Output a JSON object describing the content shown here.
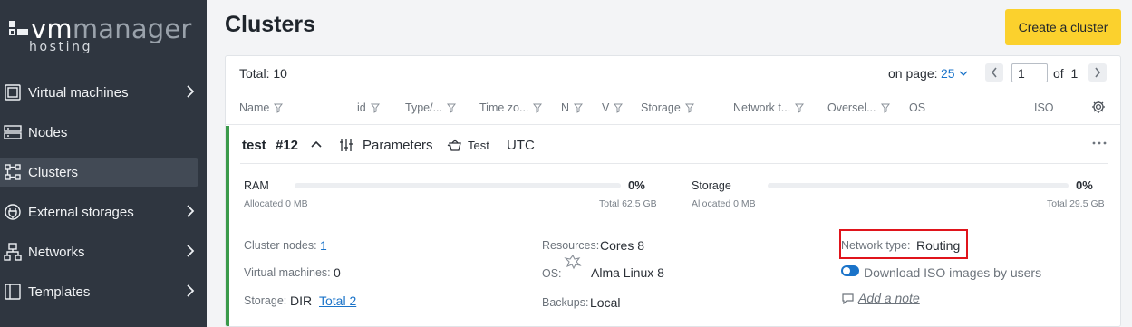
{
  "brand": {
    "name_part1": "vm",
    "name_part2": "manager",
    "subtitle": "hosting"
  },
  "sidebar": {
    "items": [
      {
        "label": "Virtual machines",
        "icon": "monitor-icon",
        "has_submenu": true
      },
      {
        "label": "Nodes",
        "icon": "server-icon",
        "has_submenu": false
      },
      {
        "label": "Clusters",
        "icon": "cluster-icon",
        "has_submenu": false,
        "active": true
      },
      {
        "label": "External storages",
        "icon": "plug-icon",
        "has_submenu": true
      },
      {
        "label": "Networks",
        "icon": "network-icon",
        "has_submenu": true
      },
      {
        "label": "Templates",
        "icon": "template-icon",
        "has_submenu": true
      }
    ]
  },
  "page": {
    "title": "Clusters",
    "create_label": "Create a cluster"
  },
  "toolbar": {
    "total": "Total: 10",
    "on_page_label": "on page:",
    "on_page_value": "25",
    "page_input": "1",
    "page_of": "of  1"
  },
  "columns": [
    "Name",
    "id",
    "Type/...",
    "Time zo...",
    "N",
    "V",
    "Storage",
    "Network t...",
    "Oversel...",
    "OS",
    "ISO"
  ],
  "cluster": {
    "name": "test",
    "id": "#12",
    "params_label": "Parameters",
    "type_label": "Test",
    "timezone": "UTC",
    "ram": {
      "label": "RAM",
      "percent": "0%",
      "allocated": "Allocated 0 MB",
      "total": "Total 62.5 GB",
      "fill": 0
    },
    "storage": {
      "label": "Storage",
      "percent": "0%",
      "allocated": "Allocated 0 MB",
      "total": "Total 29.5 GB",
      "fill": 0
    },
    "details": {
      "nodes_label": "Cluster nodes:",
      "nodes_value": "1",
      "vms_label": "Virtual machines:",
      "vms_value": "0",
      "storage_label": "Storage:",
      "storage_value": "DIR",
      "storage_total": "Total 2",
      "resources_label": "Resources:",
      "resources_value": "Cores 8",
      "os_label": "OS:",
      "os_value": "Alma Linux 8",
      "backups_label": "Backups:",
      "backups_value": "Local",
      "nettype_label": "Network type:",
      "nettype_value": "Routing",
      "iso_toggle_label": "Download ISO images by users",
      "note_label": "Add a note"
    }
  },
  "colors": {
    "sidebar_bg": "#2f3640",
    "accent_yellow": "#fbd12d",
    "link_blue": "#1a73c9",
    "status_green": "#3a9a4a",
    "highlight_red": "#e0141b"
  }
}
